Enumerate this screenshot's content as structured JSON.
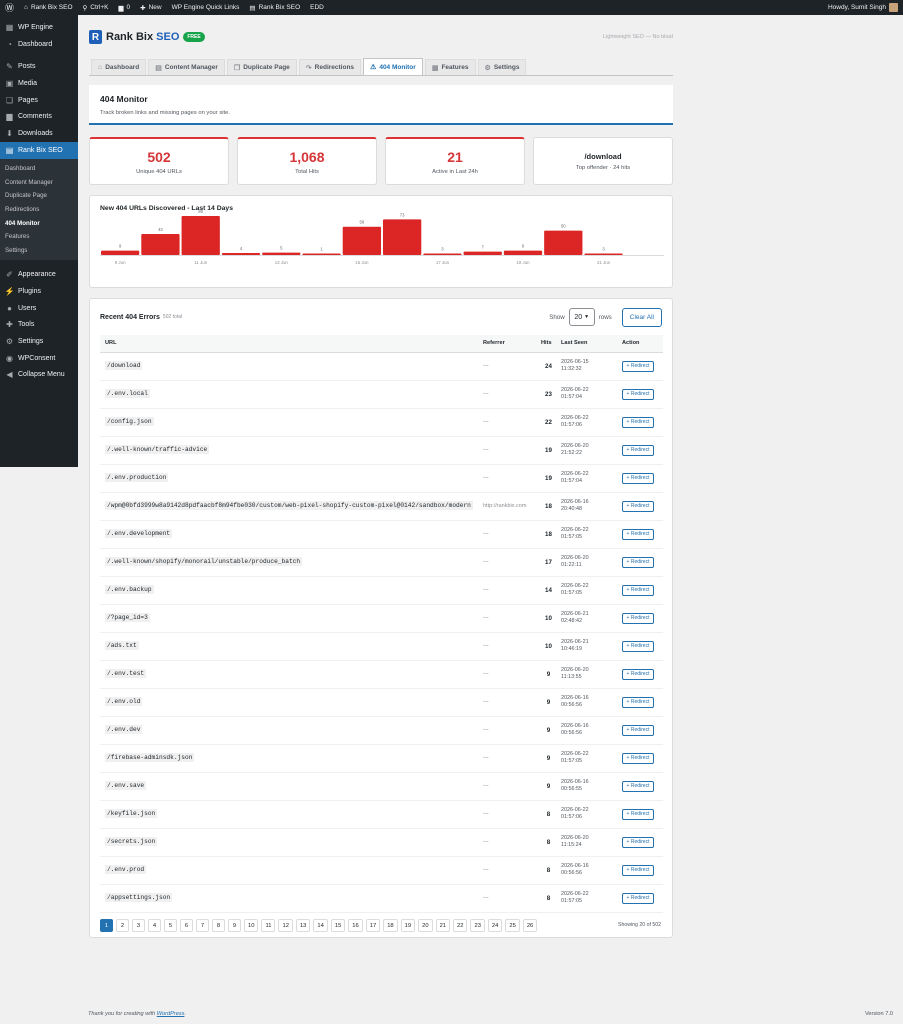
{
  "adminbar": {
    "site": "Rank Bix SEO",
    "shortcut": "Ctrl+K",
    "comments": "0",
    "new": "New",
    "quick_links": "WP Engine Quick Links",
    "plugin": "Rank Bix SEO",
    "edd": "EDD",
    "greeting": "Howdy, Sumit Singh"
  },
  "sidebar": {
    "items_top": [
      {
        "label": "WP Engine",
        "icon": "wp-engine-icon",
        "glyph": "▦"
      },
      {
        "label": "Dashboard",
        "icon": "dashboard-icon",
        "glyph": "◔"
      }
    ],
    "items_mid": [
      {
        "label": "Posts",
        "icon": "pushpin-icon",
        "glyph": "✎"
      },
      {
        "label": "Media",
        "icon": "media-icon",
        "glyph": "▣"
      },
      {
        "label": "Pages",
        "icon": "pages-icon",
        "glyph": "❏"
      },
      {
        "label": "Comments",
        "icon": "comment-icon",
        "glyph": "▆"
      },
      {
        "label": "Downloads",
        "icon": "download-icon",
        "glyph": "⬇"
      },
      {
        "label": "Rank Bix SEO",
        "icon": "rankbix-icon",
        "glyph": "▤"
      }
    ],
    "submenu": [
      "Dashboard",
      "Content Manager",
      "Duplicate Page",
      "Redirections",
      "404 Monitor",
      "Features",
      "Settings"
    ],
    "items_bottom": [
      {
        "label": "Appearance",
        "icon": "brush-icon",
        "glyph": "✐"
      },
      {
        "label": "Plugins",
        "icon": "plugin-icon",
        "glyph": "⚡"
      },
      {
        "label": "Users",
        "icon": "users-icon",
        "glyph": "●"
      },
      {
        "label": "Tools",
        "icon": "wrench-icon",
        "glyph": "✚"
      },
      {
        "label": "Settings",
        "icon": "settings-icon",
        "glyph": "⚙"
      },
      {
        "label": "WPConsent",
        "icon": "consent-icon",
        "glyph": "◉"
      },
      {
        "label": "Collapse Menu",
        "icon": "collapse-icon",
        "glyph": "◀"
      }
    ]
  },
  "brand": {
    "name1": "Rank Bix",
    "name2": "SEO",
    "badge": "FREE",
    "tagline": "Lightweight SEO — No bloat"
  },
  "tabs": [
    "Dashboard",
    "Content Manager",
    "Duplicate Page",
    "Redirections",
    "404 Monitor",
    "Features",
    "Settings"
  ],
  "tab_icons": [
    "home-icon",
    "grid-icon",
    "copy-icon",
    "redirect-arrow-icon",
    "broken-link-icon",
    "features-icon",
    "gear-icon"
  ],
  "tab_glyphs": [
    "⌂",
    "▤",
    "❐",
    "↷",
    "⚠",
    "▦",
    "⚙"
  ],
  "active_tab": 4,
  "page": {
    "title": "404 Monitor",
    "description": "Track broken links and missing pages on your site."
  },
  "stats": [
    {
      "value": "502",
      "label": "Unique 404 URLs"
    },
    {
      "value": "1,068",
      "label": "Total Hits"
    },
    {
      "value": "21",
      "label": "Active in Last 24h"
    },
    {
      "value": "/download",
      "label": "Top offender · 24 hits"
    }
  ],
  "chart_data": {
    "type": "bar",
    "title": "New 404 URLs Discovered - Last 14 Days",
    "categories": [
      "9 Jun",
      "10 Jun",
      "11 Jun",
      "12 Jun",
      "13 Jun",
      "14 Jun",
      "15 Jun",
      "16 Jun",
      "17 Jun",
      "18 Jun",
      "19 Jun",
      "20 Jun",
      "21 Jun",
      "22 Jun"
    ],
    "tick_labels": [
      "9 Jun",
      "",
      "11 Jun",
      "",
      "13 Jun",
      "",
      "15 Jun",
      "",
      "17 Jun",
      "",
      "19 Jun",
      "",
      "21 Jun",
      ""
    ],
    "values": [
      9,
      43,
      80,
      4,
      5,
      1,
      58,
      73,
      3,
      7,
      9,
      50,
      3,
      0
    ],
    "data_labels": [
      "9",
      "43",
      "80",
      "4",
      "5",
      "1",
      "58",
      "73",
      "3",
      "7",
      "9",
      "50",
      "3",
      ""
    ],
    "color": "#dc2626"
  },
  "table": {
    "title": "Recent 404 Errors",
    "total": "502 total",
    "show_label": "Show",
    "rows_per_page": "20",
    "rows_label": "rows",
    "clear_label": "Clear All",
    "columns": [
      "URL",
      "Referrer",
      "Hits",
      "Last Seen",
      "Action"
    ],
    "redirect_label": "+ Redirect",
    "rows": [
      {
        "url": "/download",
        "ref": "—",
        "hits": "24",
        "date": "2026-06-15",
        "time": "11:32:32"
      },
      {
        "url": "/.env.local",
        "ref": "—",
        "hits": "23",
        "date": "2026-06-22",
        "time": "01:57:04"
      },
      {
        "url": "/config.json",
        "ref": "—",
        "hits": "22",
        "date": "2026-06-22",
        "time": "01:57:06"
      },
      {
        "url": "/.well-known/traffic-advice",
        "ref": "—",
        "hits": "19",
        "date": "2026-06-20",
        "time": "21:52:22"
      },
      {
        "url": "/.env.production",
        "ref": "—",
        "hits": "19",
        "date": "2026-06-22",
        "time": "01:57:04"
      },
      {
        "url": "/wpm@0bfd3999w8a9142d8pdfaacbf8m94fbe030/custom/web-pixel-shopify-custom-pixel@0142/sandbox/modern",
        "ref": "http://rankbix.com",
        "hits": "18",
        "date": "2026-06-16",
        "time": "20:40:48"
      },
      {
        "url": "/.env.development",
        "ref": "—",
        "hits": "18",
        "date": "2026-06-22",
        "time": "01:57:05"
      },
      {
        "url": "/.well-known/shopify/monorail/unstable/produce_batch",
        "ref": "—",
        "hits": "17",
        "date": "2026-06-20",
        "time": "01:22:11"
      },
      {
        "url": "/.env.backup",
        "ref": "—",
        "hits": "14",
        "date": "2026-06-22",
        "time": "01:57:05"
      },
      {
        "url": "/?page_id=3",
        "ref": "—",
        "hits": "10",
        "date": "2026-06-21",
        "time": "02:48:42"
      },
      {
        "url": "/ads.txt",
        "ref": "—",
        "hits": "10",
        "date": "2026-06-21",
        "time": "10:46:19"
      },
      {
        "url": "/.env.test",
        "ref": "—",
        "hits": "9",
        "date": "2026-06-20",
        "time": "11:13:55"
      },
      {
        "url": "/.env.old",
        "ref": "—",
        "hits": "9",
        "date": "2026-06-16",
        "time": "00:56:56"
      },
      {
        "url": "/.env.dev",
        "ref": "—",
        "hits": "9",
        "date": "2026-06-16",
        "time": "00:56:56"
      },
      {
        "url": "/firebase-adminsdk.json",
        "ref": "—",
        "hits": "9",
        "date": "2026-06-22",
        "time": "01:57:05"
      },
      {
        "url": "/.env.save",
        "ref": "—",
        "hits": "9",
        "date": "2026-06-16",
        "time": "00:56:55"
      },
      {
        "url": "/keyfile.json",
        "ref": "—",
        "hits": "8",
        "date": "2026-06-22",
        "time": "01:57:06"
      },
      {
        "url": "/secrets.json",
        "ref": "—",
        "hits": "8",
        "date": "2026-06-20",
        "time": "11:15:24"
      },
      {
        "url": "/.env.prod",
        "ref": "—",
        "hits": "8",
        "date": "2026-06-16",
        "time": "00:56:56"
      },
      {
        "url": "/appsettings.json",
        "ref": "—",
        "hits": "8",
        "date": "2026-06-22",
        "time": "01:57:05"
      }
    ],
    "pages": [
      "1",
      "2",
      "3",
      "4",
      "5",
      "6",
      "7",
      "8",
      "9",
      "10",
      "11",
      "12",
      "13",
      "14",
      "15",
      "16",
      "17",
      "18",
      "19",
      "20",
      "21",
      "22",
      "23",
      "24",
      "25",
      "26"
    ],
    "current_page": "1",
    "showing": "Showing 20 of 502"
  },
  "footer": {
    "text": "Thank you for creating with",
    "link": "WordPress",
    "version": "Version 7.0"
  }
}
